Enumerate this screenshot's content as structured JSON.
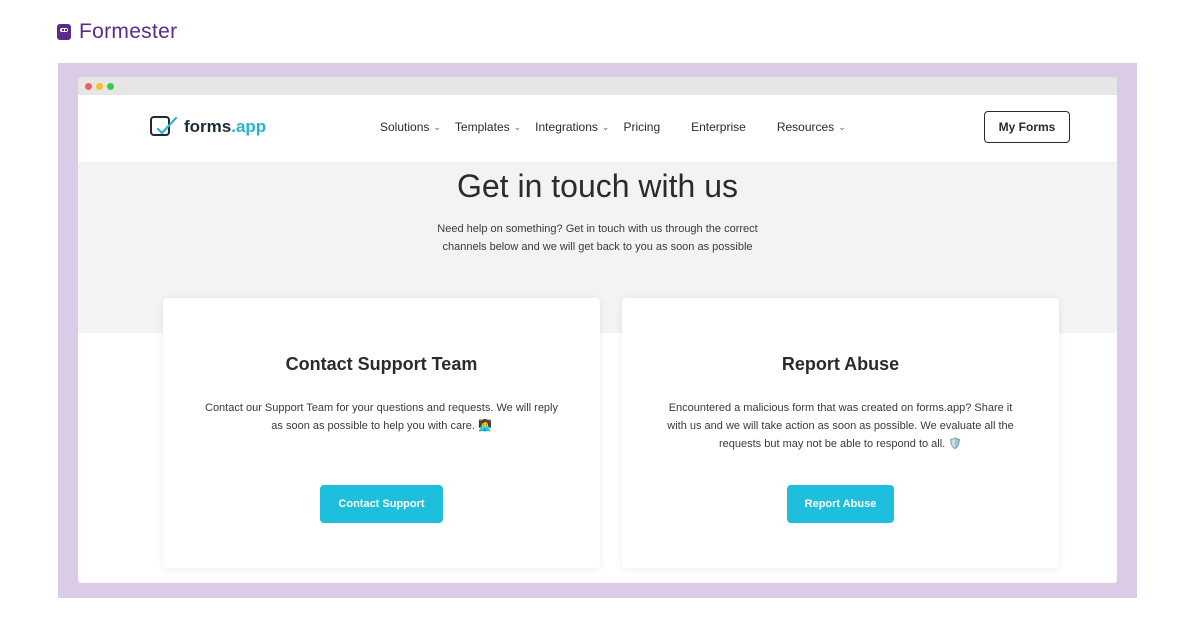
{
  "brand": {
    "name": "Formester",
    "icon": "robot-icon"
  },
  "browser": {
    "window_controls": [
      "close",
      "minimize",
      "maximize"
    ]
  },
  "site": {
    "logo_name": "forms",
    "logo_suffix": ".app",
    "nav": [
      {
        "label": "Solutions",
        "has_dropdown": true
      },
      {
        "label": "Templates",
        "has_dropdown": true
      },
      {
        "label": "Integrations",
        "has_dropdown": true
      },
      {
        "label": "Pricing",
        "has_dropdown": false
      },
      {
        "label": "Enterprise",
        "has_dropdown": false
      },
      {
        "label": "Resources",
        "has_dropdown": true
      }
    ],
    "my_forms_label": "My Forms"
  },
  "hero": {
    "title": "Get in touch with us",
    "subtitle": "Need help on something? Get in touch with us through the correct channels below and we will get back to you as soon as possible"
  },
  "cards": [
    {
      "title": "Contact Support Team",
      "text": "Contact our Support Team for your questions and requests. We will reply as soon as possible to help you with care.",
      "emoji": "👩‍💻",
      "button_label": "Contact Support"
    },
    {
      "title": "Report Abuse",
      "text": "Encountered a malicious form that was created on forms.app? Share it with us and we will take action as soon as possible. We evaluate all the requests but may not be able to respond to all.",
      "emoji": "🛡️",
      "button_label": "Report Abuse"
    }
  ],
  "colors": {
    "brand_purple": "#5b2b8c",
    "frame": "#dccbe6",
    "accent": "#1dbfdd"
  }
}
